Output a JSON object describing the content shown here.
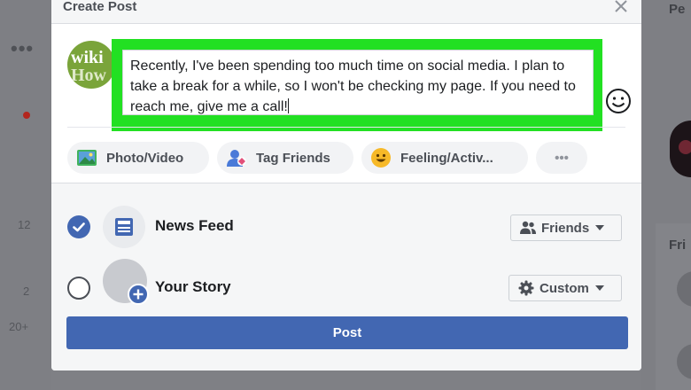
{
  "background": {
    "left_numbers": [
      "12",
      "2",
      "20+"
    ],
    "right_headers": [
      "Pe",
      "Fri"
    ]
  },
  "modal": {
    "title": "Create Post",
    "avatar_text_line1": "wiki",
    "avatar_text_line2": "How",
    "post_text": "Recently, I've been spending too much time on social media. I plan to take a break for a while, so I won't be checking my page. If you need to reach me, give me a call!",
    "highlight_color": "#22e022",
    "actions": [
      {
        "label": "Photo/Video",
        "icon": "photo-icon"
      },
      {
        "label": "Tag Friends",
        "icon": "tag-friends-icon"
      },
      {
        "label": "Feeling/Activ...",
        "icon": "feeling-icon"
      },
      {
        "label": "•••",
        "icon": "more-icon"
      }
    ],
    "destinations": [
      {
        "label": "News Feed",
        "checked": true,
        "icon": "news-feed-icon",
        "audience": "Friends",
        "audience_icon": "friends-icon"
      },
      {
        "label": "Your Story",
        "checked": false,
        "icon": "story-avatar-icon",
        "audience": "Custom",
        "audience_icon": "gear-icon"
      }
    ],
    "post_button": "Post",
    "accent_color": "#4267b2"
  }
}
